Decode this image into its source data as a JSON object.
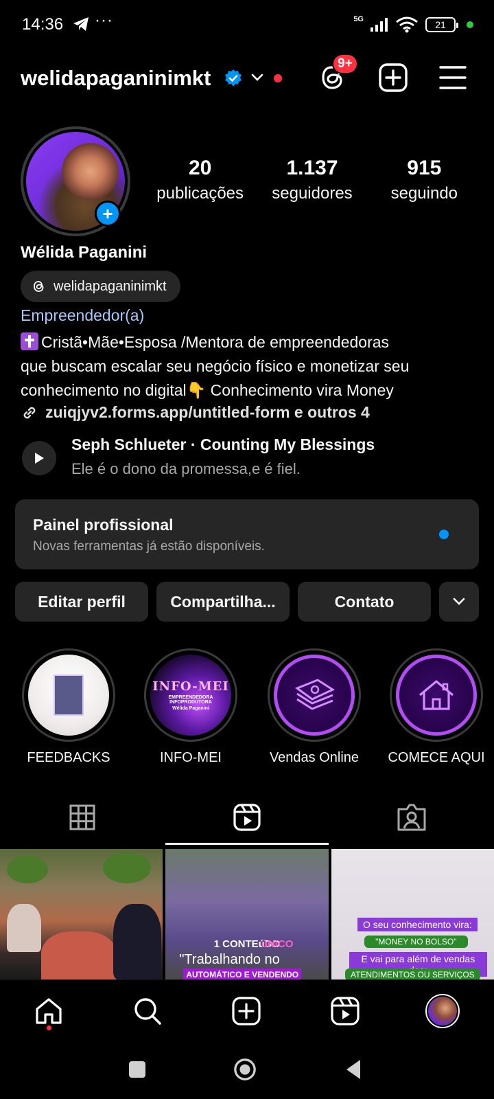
{
  "status_bar": {
    "time": "14:36",
    "extra": "···",
    "network": "5G",
    "battery": "21"
  },
  "header": {
    "username": "welidapaganinimkt",
    "notification_badge": "9+"
  },
  "profile": {
    "posts_count": "20",
    "posts_label": "publicações",
    "followers_count": "1.137",
    "followers_label": "seguidores",
    "following_count": "915",
    "following_label": "seguindo",
    "full_name": "Wélida Paganini",
    "threads_handle": "welidapaganinimkt",
    "category": "Empreendedor(a)",
    "bio_line1": "Cristã•Mãe•Esposa /Mentora de empreendedoras",
    "bio_line2": "que buscam escalar seu negócio físico e monetizar seu",
    "bio_line3": "conhecimento no digital👇 Conhecimento vira Money",
    "link": "zuiqjyv2.forms.app/untitled-form e outros 4"
  },
  "music": {
    "title": "Seph Schlueter · Counting My Blessings",
    "subtitle": "Ele é o dono da promessa,e é fiel."
  },
  "pro_panel": {
    "title": "Painel profissional",
    "subtitle": "Novas ferramentas já estão disponíveis."
  },
  "actions": {
    "edit": "Editar perfil",
    "share": "Compartilha...",
    "contact": "Contato"
  },
  "highlights": [
    {
      "label": "FEEDBACKS"
    },
    {
      "label": "INFO-MEI",
      "cover_title": "INFO-MEI",
      "cover_text": "EMPREENDEDORA INFOPRODUTORA",
      "cover_name": "Wélida Paganini"
    },
    {
      "label": "Vendas Online"
    },
    {
      "label": "COMECE AQUI"
    }
  ],
  "grid": {
    "post2_line1a": "1 ",
    "post2_line1b": "úNICO",
    "post2_line1c": " CONTEúDO",
    "post2_line2": "\"Trabalhando no",
    "post2_line3": "AUTOMÁTICO E VENDENDO",
    "post3_line1": "O seu conhecimento vira:",
    "post3_line2": "\"MONEY NO BOLSO\"",
    "post3_line3": "E vai para além de vendas dos:",
    "post3_line4": "ATENDIMENTOS OU SERVIÇOS"
  },
  "colors": {
    "accent_blue": "#0095f6",
    "notification_red": "#ff3040",
    "category_blue": "#a8c7fa",
    "panel_bg": "#262626"
  }
}
